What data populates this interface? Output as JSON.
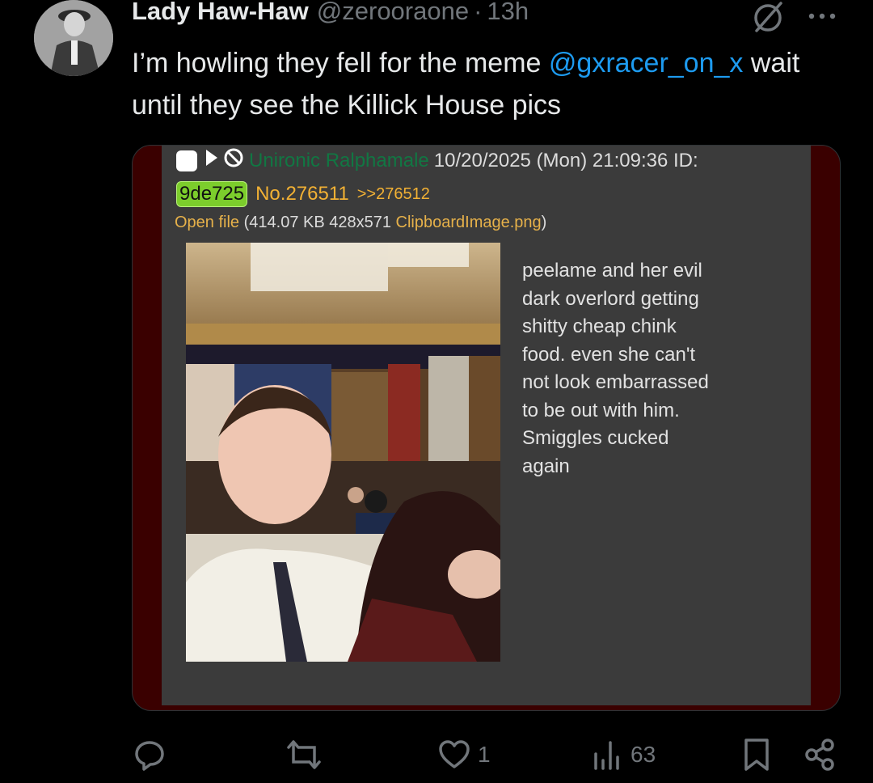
{
  "tweet": {
    "display_name": "Lady Haw-Haw",
    "handle": "@zerooraone",
    "separator": "·",
    "time": "13h",
    "text_part1": "I’m howling they fell for the meme ",
    "mention": "@gxracer_on_x",
    "text_part2": " wait until they see the Killick House pics"
  },
  "embedded_post": {
    "poster_name": "Unironic Ralphamale",
    "datetime": "10/20/2025 (Mon) 21:09:36 ID:",
    "poster_id": "9de725",
    "post_number": "No.276511",
    "reply_link": ">>276512",
    "file_label": "Open file",
    "file_meta_open": " (414.07 KB 428x571 ",
    "file_name": "ClipboardImage.png",
    "file_meta_close": ")",
    "body": "peelame and her evil\ndark overlord getting\nshitty cheap chink\nfood. even she can't\nnot look embarrassed\nto be out with him.\nSmiggles cucked\nagain"
  },
  "actions": {
    "reply_count": "",
    "repost_count": "",
    "like_count": "1",
    "views_count": "63"
  },
  "icons": {
    "reply": "reply-icon",
    "repost": "repost-icon",
    "like": "heart-icon",
    "views": "views-icon",
    "bookmark": "bookmark-icon",
    "share": "share-icon",
    "more": "more-icon",
    "no_entry": "no-entry-icon"
  },
  "colors": {
    "background": "#000000",
    "text_primary": "#e7e9ea",
    "text_secondary": "#71767b",
    "link": "#1d9bf0",
    "board_panel": "#3b3b3b",
    "board_name": "#117743",
    "board_id_badge": "#7ccd2c",
    "board_link": "#f2b134"
  }
}
